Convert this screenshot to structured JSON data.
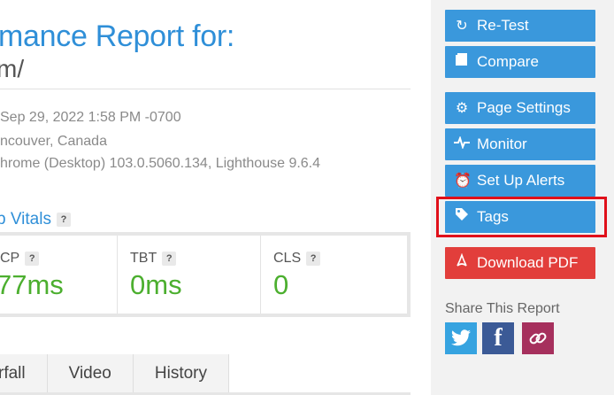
{
  "report": {
    "title": "mance Report for:",
    "url": "m/",
    "meta_date": "Sep 29, 2022 1:58 PM -0700",
    "meta_location": "ncouver, Canada",
    "meta_browser": "hrome (Desktop) 103.0.5060.134, Lighthouse 9.6.4",
    "vitals_label": "b Vitals",
    "help_glyph": "?",
    "vitals": [
      {
        "name": "CP",
        "value": "77ms"
      },
      {
        "name": "TBT",
        "value": "0ms"
      },
      {
        "name": "CLS",
        "value": "0"
      }
    ],
    "tabs": [
      "rfall",
      "Video",
      "History"
    ]
  },
  "sidebar": {
    "buttons": {
      "retest": "Re-Test",
      "compare": "Compare",
      "page_settings": "Page Settings",
      "monitor": "Monitor",
      "alerts": "Set Up Alerts",
      "tags": "Tags",
      "download_pdf": "Download PDF"
    },
    "share_label": "Share This Report",
    "share_icons": [
      "twitter-icon",
      "facebook-icon",
      "link-icon"
    ]
  },
  "colors": {
    "accent_blue": "#3a98dc",
    "danger_red": "#e23e3b",
    "good_green": "#4caf2f",
    "highlight_red": "#e0101a"
  }
}
